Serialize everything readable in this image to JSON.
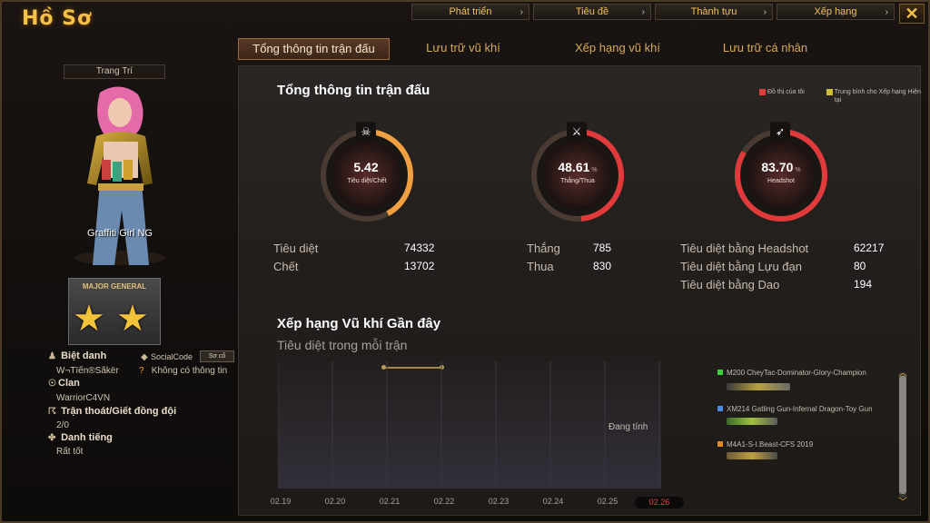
{
  "header": {
    "title": "Hồ Sơ",
    "nav": [
      "Phát triển",
      "Tiêu đề",
      "Thành tựu",
      "Xếp hạng"
    ],
    "close": "✕"
  },
  "tabs": [
    "Tổng thông tin trận đấu",
    "Lưu trữ vũ khí",
    "Xếp hạng vũ khí",
    "Lưu trữ cá nhân"
  ],
  "left": {
    "decor_label": "Trang Trí",
    "character_name": "Graffiti Girl NG",
    "rank_text": "MAJOR GENERAL",
    "nickname_label": "Biệt danh",
    "nickname": "W¬Tïến®Sãkër",
    "social_label": "SocialCode",
    "social_button": "Sơ cố",
    "no_info": "Không có thông tin",
    "clan_label": "Clan",
    "clan": "WarriorC4VN",
    "escape_label": "Trận thoát/Giết đồng đội",
    "escape": "2/0",
    "fame_label": "Danh tiếng",
    "fame": "Rất tốt"
  },
  "overview": {
    "title": "Tổng thông tin trận đấu",
    "legend_mine": "Đồ thị của tôi",
    "legend_avg": "Trung bình cho Xếp hạng Hiện tại",
    "gauges": [
      {
        "value": "5.42",
        "unit": "",
        "label": "Tiêu diệt/Chết",
        "icon": "skull-icon",
        "glyph": "☠",
        "fraction": 0.42
      },
      {
        "value": "48.61",
        "unit": "%",
        "label": "Thắng/Thua",
        "icon": "crossed-rifles-icon",
        "glyph": "⚔",
        "fraction": 0.4861
      },
      {
        "value": "83.70",
        "unit": "%",
        "label": "Headshot",
        "icon": "rifle-icon",
        "glyph": "➶",
        "fraction": 0.837
      }
    ],
    "stats": [
      {
        "label": "Tiêu diệt",
        "value": "74332"
      },
      {
        "label": "Chết",
        "value": "13702"
      },
      {
        "label": "Thắng",
        "value": "785"
      },
      {
        "label": "Thua",
        "value": "830"
      },
      {
        "label": "Tiêu diệt bằng Headshot",
        "value": "62217"
      },
      {
        "label": "Tiêu diệt bằng Lựu đạn",
        "value": "80"
      },
      {
        "label": "Tiêu diệt bằng Dao",
        "value": "194"
      }
    ]
  },
  "weapon_rank": {
    "title": "Xếp hạng Vũ khí Gần đây",
    "subtitle": "Tiêu diệt trong mỗi trận",
    "status": "Đang tính",
    "dates": [
      "02.19",
      "02.20",
      "02.21",
      "02.22",
      "02.23",
      "02.24",
      "02.25",
      "02.26"
    ],
    "weapons": [
      {
        "name": "M200 CheyTac-Dominator-Glory-Champion",
        "color": "#3ad03a"
      },
      {
        "name": "XM214 Gatling Gun-Infernal Dragon-Toy Gun",
        "color": "#4a8ae0"
      },
      {
        "name": "M4A1-S-I.Beast-CFS 2019",
        "color": "#e08a20"
      }
    ]
  },
  "colors": {
    "gold": "#f4c24a",
    "gauge_red": "#e03a3a",
    "gauge_orange": "#f0a040"
  }
}
